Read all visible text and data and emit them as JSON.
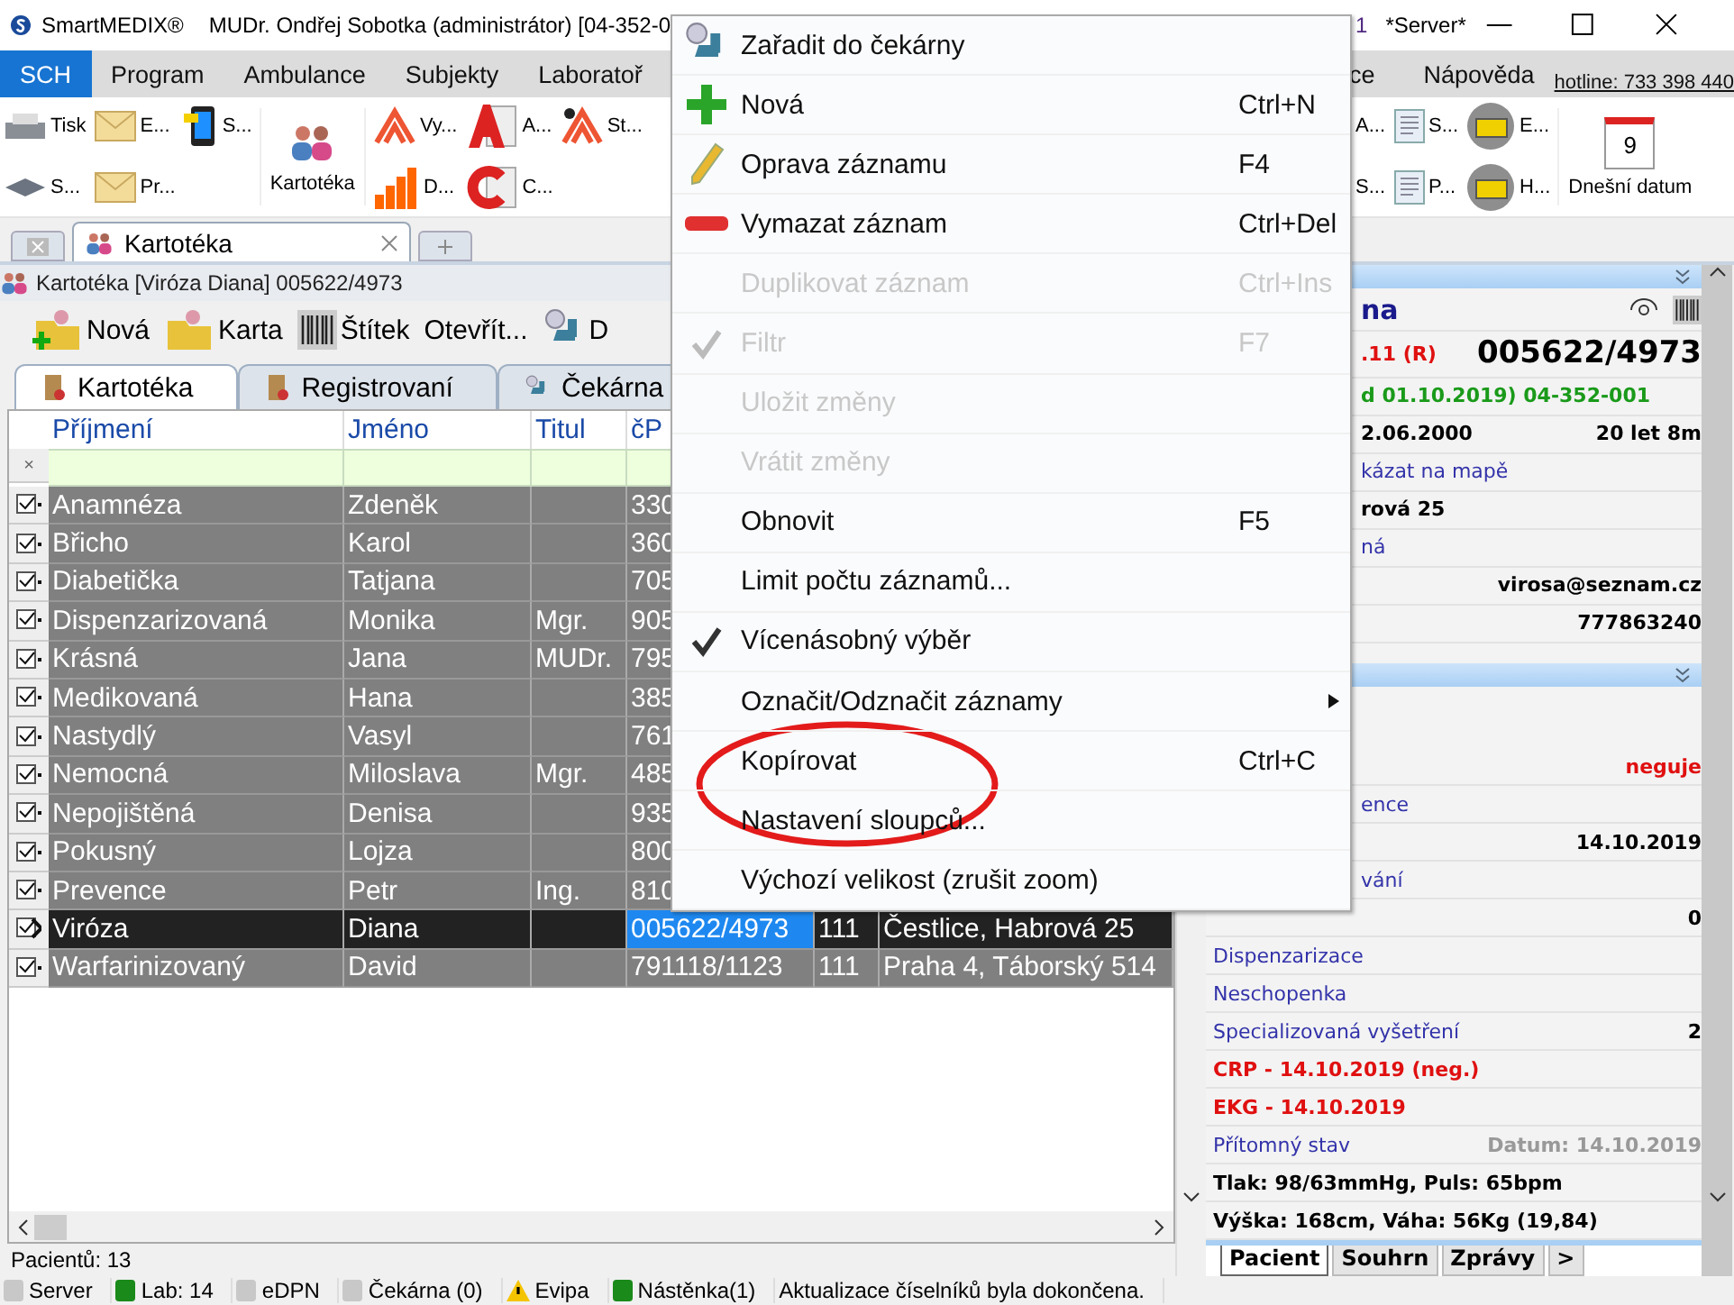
{
  "window": {
    "app": "SmartMEDIX®",
    "title": "MUDr. Ondřej Sobotka (administrátor) [04-352-0",
    "title_end": "1",
    "server": "*Server*"
  },
  "menubar": {
    "items": [
      {
        "label": "SCH",
        "selected": true
      },
      {
        "label": "Program",
        "selected": false
      },
      {
        "label": "Ambulance",
        "selected": false
      },
      {
        "label": "Subjekty",
        "selected": false
      },
      {
        "label": "Laboratoř",
        "selected": false
      }
    ],
    "items_right": [
      {
        "label": "ce",
        "selected": false
      },
      {
        "label": "Nápověda",
        "selected": false
      }
    ],
    "hotline": "hotline: 733 398 440"
  },
  "ribbon": {
    "left": [
      "Tisk",
      "E...",
      "S...",
      "S...",
      "Pr..."
    ],
    "kartoteka": "Kartotéka",
    "reports": [
      "Vy...",
      "A...",
      "St...",
      "D...",
      "C..."
    ],
    "right": [
      "A...",
      "S...",
      "S...",
      "P...",
      "E...",
      "H..."
    ],
    "today": {
      "day": "9",
      "label": "Dnešní datum"
    }
  },
  "doc_tabs": [
    {
      "label": "Kartotéka",
      "selected": true
    }
  ],
  "subwindow": {
    "title": "Kartotéka [Viróza Diana] 005622/4973",
    "toolbar": [
      "Nová",
      "Karta",
      "Štítek",
      "Otevřít...",
      "D"
    ],
    "tabs": [
      {
        "label": "Kartotéka",
        "selected": true
      },
      {
        "label": "Registrovaní",
        "selected": false
      },
      {
        "label": "Čekárna",
        "selected": false
      }
    ]
  },
  "table": {
    "columns": [
      "Příjmení",
      "Jméno",
      "Titul",
      "čP"
    ],
    "filter_clear": "×",
    "rows": [
      {
        "surname": "Anamnéza",
        "name": "Zdeněk",
        "title": "",
        "cp": "330",
        "checked": true,
        "selected": false
      },
      {
        "surname": "Břicho",
        "name": "Karol",
        "title": "",
        "cp": "360",
        "checked": true,
        "selected": false
      },
      {
        "surname": "Diabetička",
        "name": "Tatjana",
        "title": "",
        "cp": "705",
        "checked": true,
        "selected": false
      },
      {
        "surname": "Dispenzarizovaná",
        "name": "Monika",
        "title": "Mgr.",
        "cp": "905",
        "checked": true,
        "selected": false
      },
      {
        "surname": "Krásná",
        "name": "Jana",
        "title": "MUDr.",
        "cp": "795",
        "checked": true,
        "selected": false
      },
      {
        "surname": "Medikovaná",
        "name": "Hana",
        "title": "",
        "cp": "385",
        "checked": true,
        "selected": false
      },
      {
        "surname": "Nastydlý",
        "name": "Vasyl",
        "title": "",
        "cp": "761",
        "checked": true,
        "selected": false
      },
      {
        "surname": "Nemocná",
        "name": "Miloslava",
        "title": "Mgr.",
        "cp": "485",
        "checked": true,
        "selected": false
      },
      {
        "surname": "Nepojištěná",
        "name": "Denisa",
        "title": "",
        "cp": "935",
        "checked": true,
        "selected": false
      },
      {
        "surname": "Pokusný",
        "name": "Lojza",
        "title": "",
        "cp": "800",
        "checked": true,
        "selected": false
      },
      {
        "surname": "Prevence",
        "name": "Petr",
        "title": "Ing.",
        "cp": "810",
        "checked": true,
        "selected": false
      },
      {
        "surname": "Viróza",
        "name": "Diana",
        "title": "",
        "cp": "005622/4973",
        "col5": "111",
        "col6": "Čestlice, Habrová 25",
        "checked": true,
        "selected": true
      },
      {
        "surname": "Warfarinizovaný",
        "name": "David",
        "title": "",
        "cp": "791118/1123",
        "col5": "111",
        "col6": "Praha 4, Táborský 514",
        "checked": true,
        "selected": false
      }
    ],
    "count": "Pacientů: 13"
  },
  "detail": {
    "section1": [
      {
        "left": {
          "text": "na",
          "kind": "title"
        }
      },
      {
        "left": {
          "text": ".11 (R)",
          "kind": "red"
        },
        "right": {
          "text": "005622/4973",
          "kind": "big"
        }
      },
      {
        "left": {
          "text": "d 01.10.2019) 04-352-001",
          "kind": "green"
        }
      },
      {
        "left": {
          "text": "2.06.2000",
          "kind": "bold"
        },
        "right": {
          "text": "20 let 8m",
          "kind": "bold"
        }
      },
      {
        "left": {
          "text": "kázat na mapě",
          "kind": "link"
        }
      },
      {
        "left": {
          "text": "rová 25",
          "kind": "bold"
        }
      },
      {
        "left": {
          "text": "ná",
          "kind": "link"
        }
      },
      {
        "right": {
          "text": "virosa@seznam.cz",
          "kind": "bold"
        }
      },
      {
        "right": {
          "text": "777863240",
          "kind": "bold"
        }
      }
    ],
    "section2": [
      {
        "right": {
          "text": "neguje",
          "kind": "red"
        }
      },
      {
        "left": {
          "text": "ence",
          "kind": "link"
        }
      },
      {
        "right": {
          "text": "14.10.2019",
          "kind": "bold"
        }
      },
      {
        "left": {
          "text": "vání",
          "kind": "link"
        }
      },
      {
        "right": {
          "text": "0",
          "kind": "bold"
        }
      },
      {
        "left": {
          "text": "Dispenzarizace",
          "kind": "link"
        }
      },
      {
        "left": {
          "text": "Neschopenka",
          "kind": "link"
        }
      },
      {
        "left": {
          "text": "Specializovaná vyšetření",
          "kind": "link"
        },
        "right": {
          "text": "2",
          "kind": "bold"
        }
      },
      {
        "left": {
          "text": "CRP - 14.10.2019 (neg.)",
          "kind": "red"
        }
      },
      {
        "left": {
          "text": "EKG - 14.10.2019",
          "kind": "red"
        }
      },
      {
        "left": {
          "text": "Přítomný stav",
          "kind": "link"
        },
        "right": {
          "text": "Datum: 14.10.2019",
          "kind": "grey"
        }
      },
      {
        "left": {
          "text": "Tlak: 98/63mmHg, Puls: 65bpm",
          "kind": "bold"
        }
      },
      {
        "left": {
          "text": "Výška: 168cm, Váha: 56Kg (19,84)",
          "kind": "bold"
        }
      }
    ],
    "tabs": [
      {
        "label": "Pacient",
        "selected": true
      },
      {
        "label": "Souhrn",
        "selected": false
      },
      {
        "label": "Zprávy",
        "selected": false
      },
      {
        "label": ">",
        "selected": false
      }
    ]
  },
  "context_menu": [
    {
      "label": "Zařadit do čekárny",
      "disabled": false,
      "checked": false
    },
    {
      "label": "Nová",
      "shortcut": "Ctrl+N",
      "disabled": false,
      "checked": false
    },
    {
      "label": "Oprava záznamu",
      "shortcut": "F4",
      "disabled": false,
      "checked": false
    },
    {
      "label": "Vymazat záznam",
      "shortcut": "Ctrl+Del",
      "disabled": false,
      "checked": false
    },
    {
      "label": "Duplikovat záznam",
      "shortcut": "Ctrl+Ins",
      "disabled": true,
      "checked": false
    },
    {
      "label": "Filtr",
      "shortcut": "F7",
      "disabled": true,
      "checked": true
    },
    {
      "label": "Uložit změny",
      "disabled": true,
      "checked": false
    },
    {
      "label": "Vrátit změny",
      "disabled": true,
      "checked": false
    },
    {
      "label": "Obnovit",
      "shortcut": "F5",
      "disabled": false,
      "checked": false
    },
    {
      "label": "Limit počtu záznamů...",
      "disabled": false,
      "checked": false
    },
    {
      "label": "Vícenásobný výběr",
      "disabled": false,
      "checked": true
    },
    {
      "label": "Označit/Odznačit záznamy",
      "disabled": false,
      "checked": false,
      "submenu": true
    },
    {
      "label": "Kopírovat",
      "shortcut": "Ctrl+C",
      "disabled": false,
      "checked": false
    },
    {
      "label": "Nastavení sloupců...",
      "disabled": false,
      "checked": false
    },
    {
      "label": "Výchozí velikost (zrušit zoom)",
      "disabled": false,
      "checked": false
    }
  ],
  "status_bar": [
    {
      "label": "Server",
      "kind": "led",
      "color": "#c8c8c8"
    },
    {
      "label": "Lab: 14",
      "kind": "led",
      "color": "#1a8a1a"
    },
    {
      "label": "eDPN",
      "kind": "led",
      "color": "#c8c8c8"
    },
    {
      "label": "Čekárna (0)",
      "kind": "led",
      "color": "#c8c8c8"
    },
    {
      "label": "Evipa",
      "kind": "warning"
    },
    {
      "label": "Nástěnka(1)",
      "kind": "led",
      "color": "#1a8a1a"
    },
    {
      "label": "Aktualizace číselníků byla dokončena.",
      "kind": "text"
    }
  ]
}
